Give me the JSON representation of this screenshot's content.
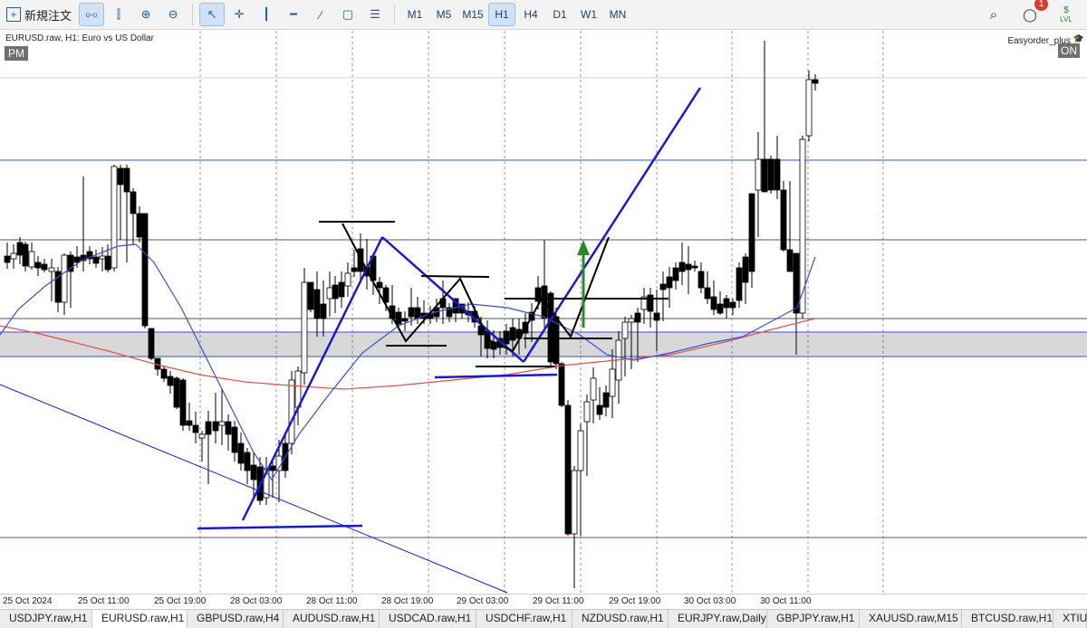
{
  "toolbar": {
    "new_order_label": "新規注文",
    "timeframes": [
      "M1",
      "M5",
      "M15",
      "H1",
      "H4",
      "D1",
      "W1",
      "MN"
    ],
    "active_timeframe": "H1",
    "notification_count": "1",
    "lvl_label": "LVL"
  },
  "chart": {
    "title": "EURUSD.raw, H1:  Euro vs US Dollar",
    "pm_label": "PM",
    "ea_name": "Easyorder_plus",
    "on_label": "ON",
    "x_labels": [
      "25 Oct 2024",
      "25 Oct 11:00",
      "25 Oct 19:00",
      "28 Oct 03:00",
      "28 Oct 11:00",
      "28 Oct 19:00",
      "29 Oct 03:00",
      "29 Oct 11:00",
      "29 Oct 19:00",
      "30 Oct 03:00",
      "30 Oct 11:00"
    ]
  },
  "tabs": [
    {
      "label": "USDJPY.raw,H1"
    },
    {
      "label": "EURUSD.raw,H1"
    },
    {
      "label": "GBPUSD.raw,H4"
    },
    {
      "label": "AUDUSD.raw,H1"
    },
    {
      "label": "USDCAD.raw,H1"
    },
    {
      "label": "USDCHF.raw,H1"
    },
    {
      "label": "NZDUSD.raw,H1"
    },
    {
      "label": "EURJPY.raw,Daily"
    },
    {
      "label": "GBPJPY.raw,H1"
    },
    {
      "label": "XAUUSD.raw,M15"
    },
    {
      "label": "BTCUSD.raw,H1"
    },
    {
      "label": "XTIU"
    }
  ],
  "active_tab": "EURUSD.raw,H1",
  "colors": {
    "accent": "#1f5fae",
    "up_candle": "#ffffff",
    "down_candle": "#000000",
    "trend_line": "#1a1acc",
    "ma_red": "#d9534f",
    "ma_blue": "#3a4fd0",
    "zone": "#d8d8d8",
    "arrow": "#2a8a2a"
  }
}
